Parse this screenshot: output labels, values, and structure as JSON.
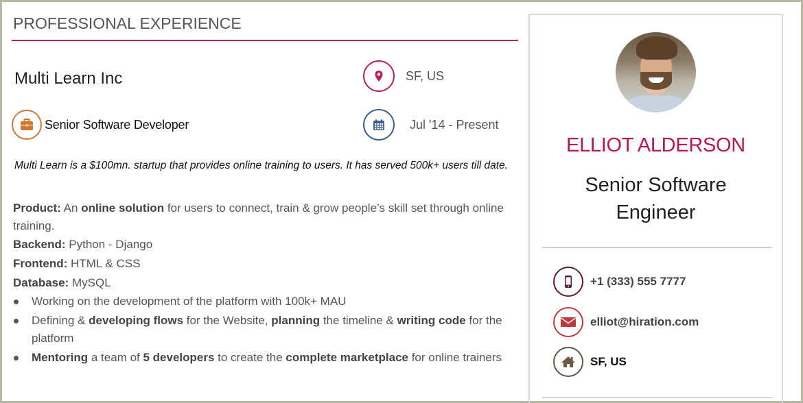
{
  "section": {
    "title": "PROFESSIONAL EXPERIENCE"
  },
  "job": {
    "company": "Multi Learn Inc",
    "role": "Senior Software Developer",
    "location": "SF, US",
    "dates": "Jul '14 -  Present",
    "summary": "Multi Learn is a $100mn. startup that provides online training to users. It has served 500k+ users till date.",
    "product": {
      "label": "Product:",
      "pre": " An ",
      "bold": "online solution",
      "post": " for users to connect, train & grow people’s skill set through online training."
    },
    "backend": {
      "label": "Backend:",
      "value": " Python - Django"
    },
    "frontend": {
      "label": "Frontend:",
      "value": " HTML & CSS"
    },
    "database": {
      "label": "Database:",
      "value": " MySQL"
    },
    "bullets": [
      {
        "parts": [
          {
            "text": "Working on the development of the platform with 100k+ MAU",
            "bold": false
          }
        ]
      },
      {
        "parts": [
          {
            "text": "Defining & ",
            "bold": false
          },
          {
            "text": "developing flows",
            "bold": true
          },
          {
            "text": " for the Website, ",
            "bold": false
          },
          {
            "text": "planning",
            "bold": true
          },
          {
            "text": " the timeline & ",
            "bold": false
          },
          {
            "text": "writing code",
            "bold": true
          },
          {
            "text": " for the platform",
            "bold": false
          }
        ]
      },
      {
        "parts": [
          {
            "text": "Mentoring",
            "bold": true
          },
          {
            "text": " a team of ",
            "bold": false
          },
          {
            "text": "5 developers",
            "bold": true
          },
          {
            "text": " to create the ",
            "bold": false
          },
          {
            "text": "complete marketplace",
            "bold": true
          },
          {
            "text": " for online trainers",
            "bold": false
          }
        ]
      }
    ]
  },
  "profile": {
    "name": "ELLIOT ALDERSON",
    "title_line1": "Senior Software",
    "title_line2": "Engineer",
    "phone": "+1 (333) 555 7777",
    "email": "elliot@hiration.com",
    "address": "SF, US"
  },
  "icons": {
    "briefcase": "briefcase-icon",
    "location": "map-pin-icon",
    "calendar": "calendar-icon",
    "phone": "mobile-phone-icon",
    "email": "envelope-icon",
    "home": "home-icon"
  },
  "colors": {
    "accent": "#b8215c",
    "name": "#b8184f",
    "briefcase": "#c77a3a",
    "calendar": "#3f5f8f",
    "phone": "#5a1a3c",
    "email": "#c0393e",
    "home": "#5e5848",
    "card_border": "#e4d3da"
  }
}
